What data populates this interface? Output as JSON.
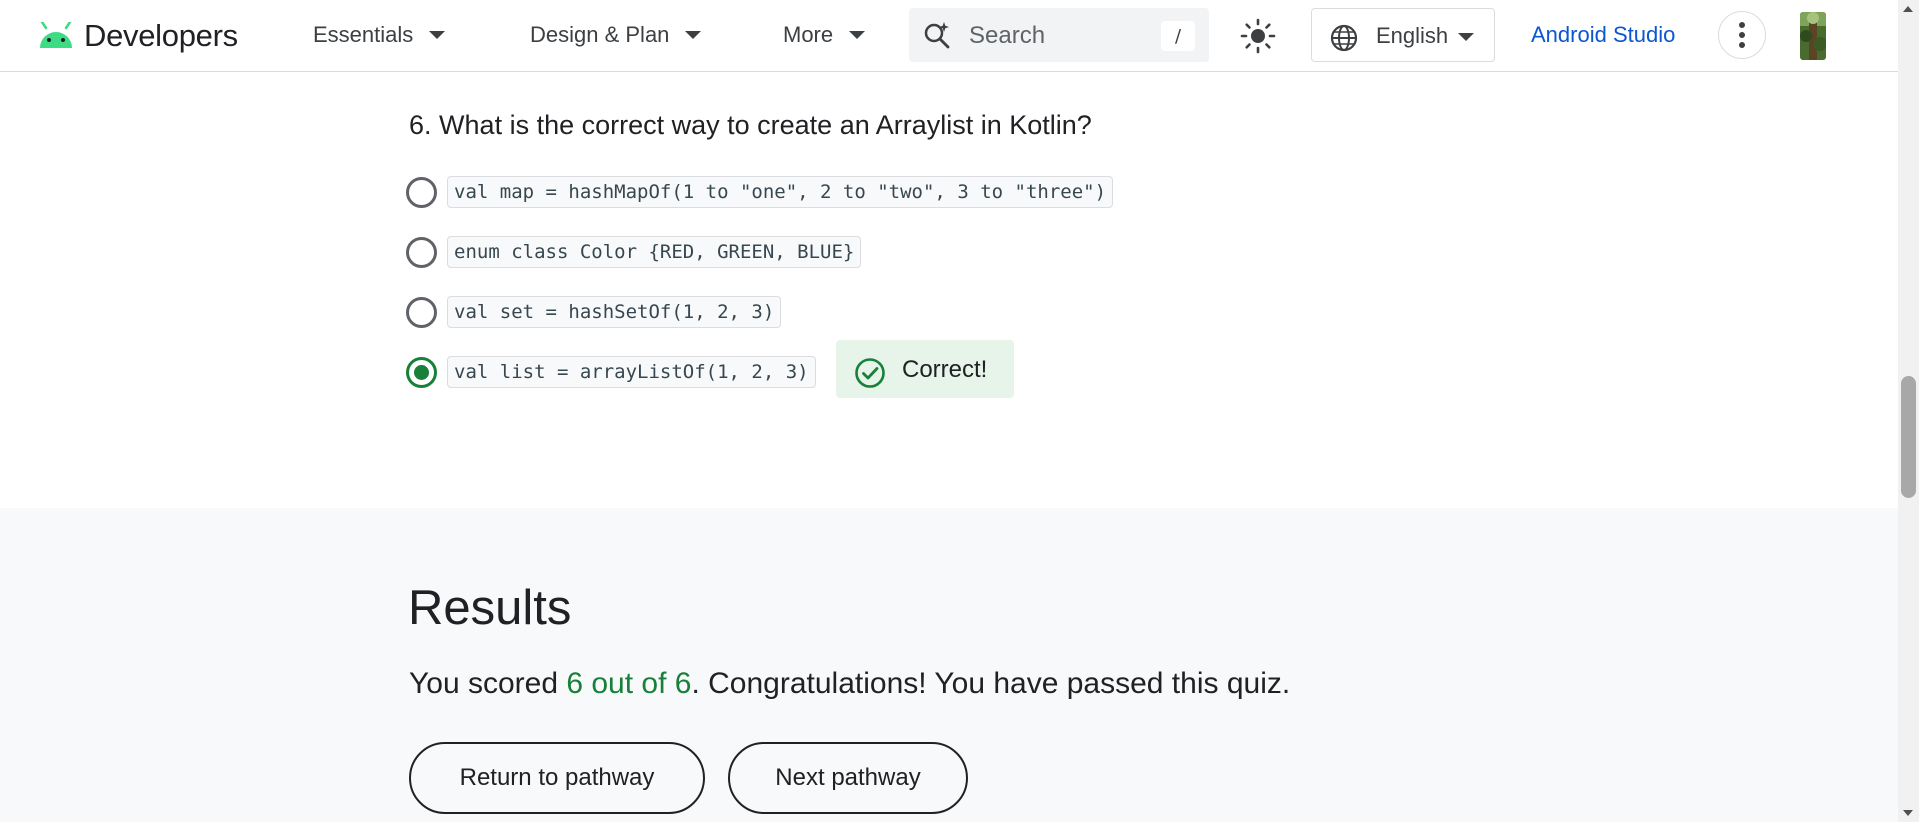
{
  "header": {
    "brand": "Developers",
    "nav": [
      {
        "label": "Essentials"
      },
      {
        "label": "Design & Plan"
      },
      {
        "label": "More"
      }
    ],
    "search": {
      "placeholder": "Search",
      "shortcut": "/"
    },
    "language": "English",
    "studio_link": "Android Studio"
  },
  "question": {
    "number": "6.",
    "text": "What is the correct way to create an Arraylist in Kotlin?",
    "options": [
      {
        "code": "val map = hashMapOf(1 to \"one\", 2 to \"two\", 3 to \"three\")",
        "selected": false
      },
      {
        "code": "enum class Color {RED, GREEN, BLUE}",
        "selected": false
      },
      {
        "code": "val set = hashSetOf(1, 2, 3)",
        "selected": false
      },
      {
        "code": "val list = arrayListOf(1, 2, 3)",
        "selected": true
      }
    ],
    "feedback": "Correct!"
  },
  "results": {
    "title": "Results",
    "score_prefix": "You scored ",
    "score_value": "6 out of 6",
    "score_suffix": ". Congratulations! You have passed this quiz.",
    "buttons": {
      "return": "Return to pathway",
      "next": "Next pathway"
    }
  },
  "colors": {
    "accent_green": "#188038",
    "link_blue": "#0b57d0",
    "android_green": "#3ddc84",
    "success_bg": "#e6f4ea"
  }
}
